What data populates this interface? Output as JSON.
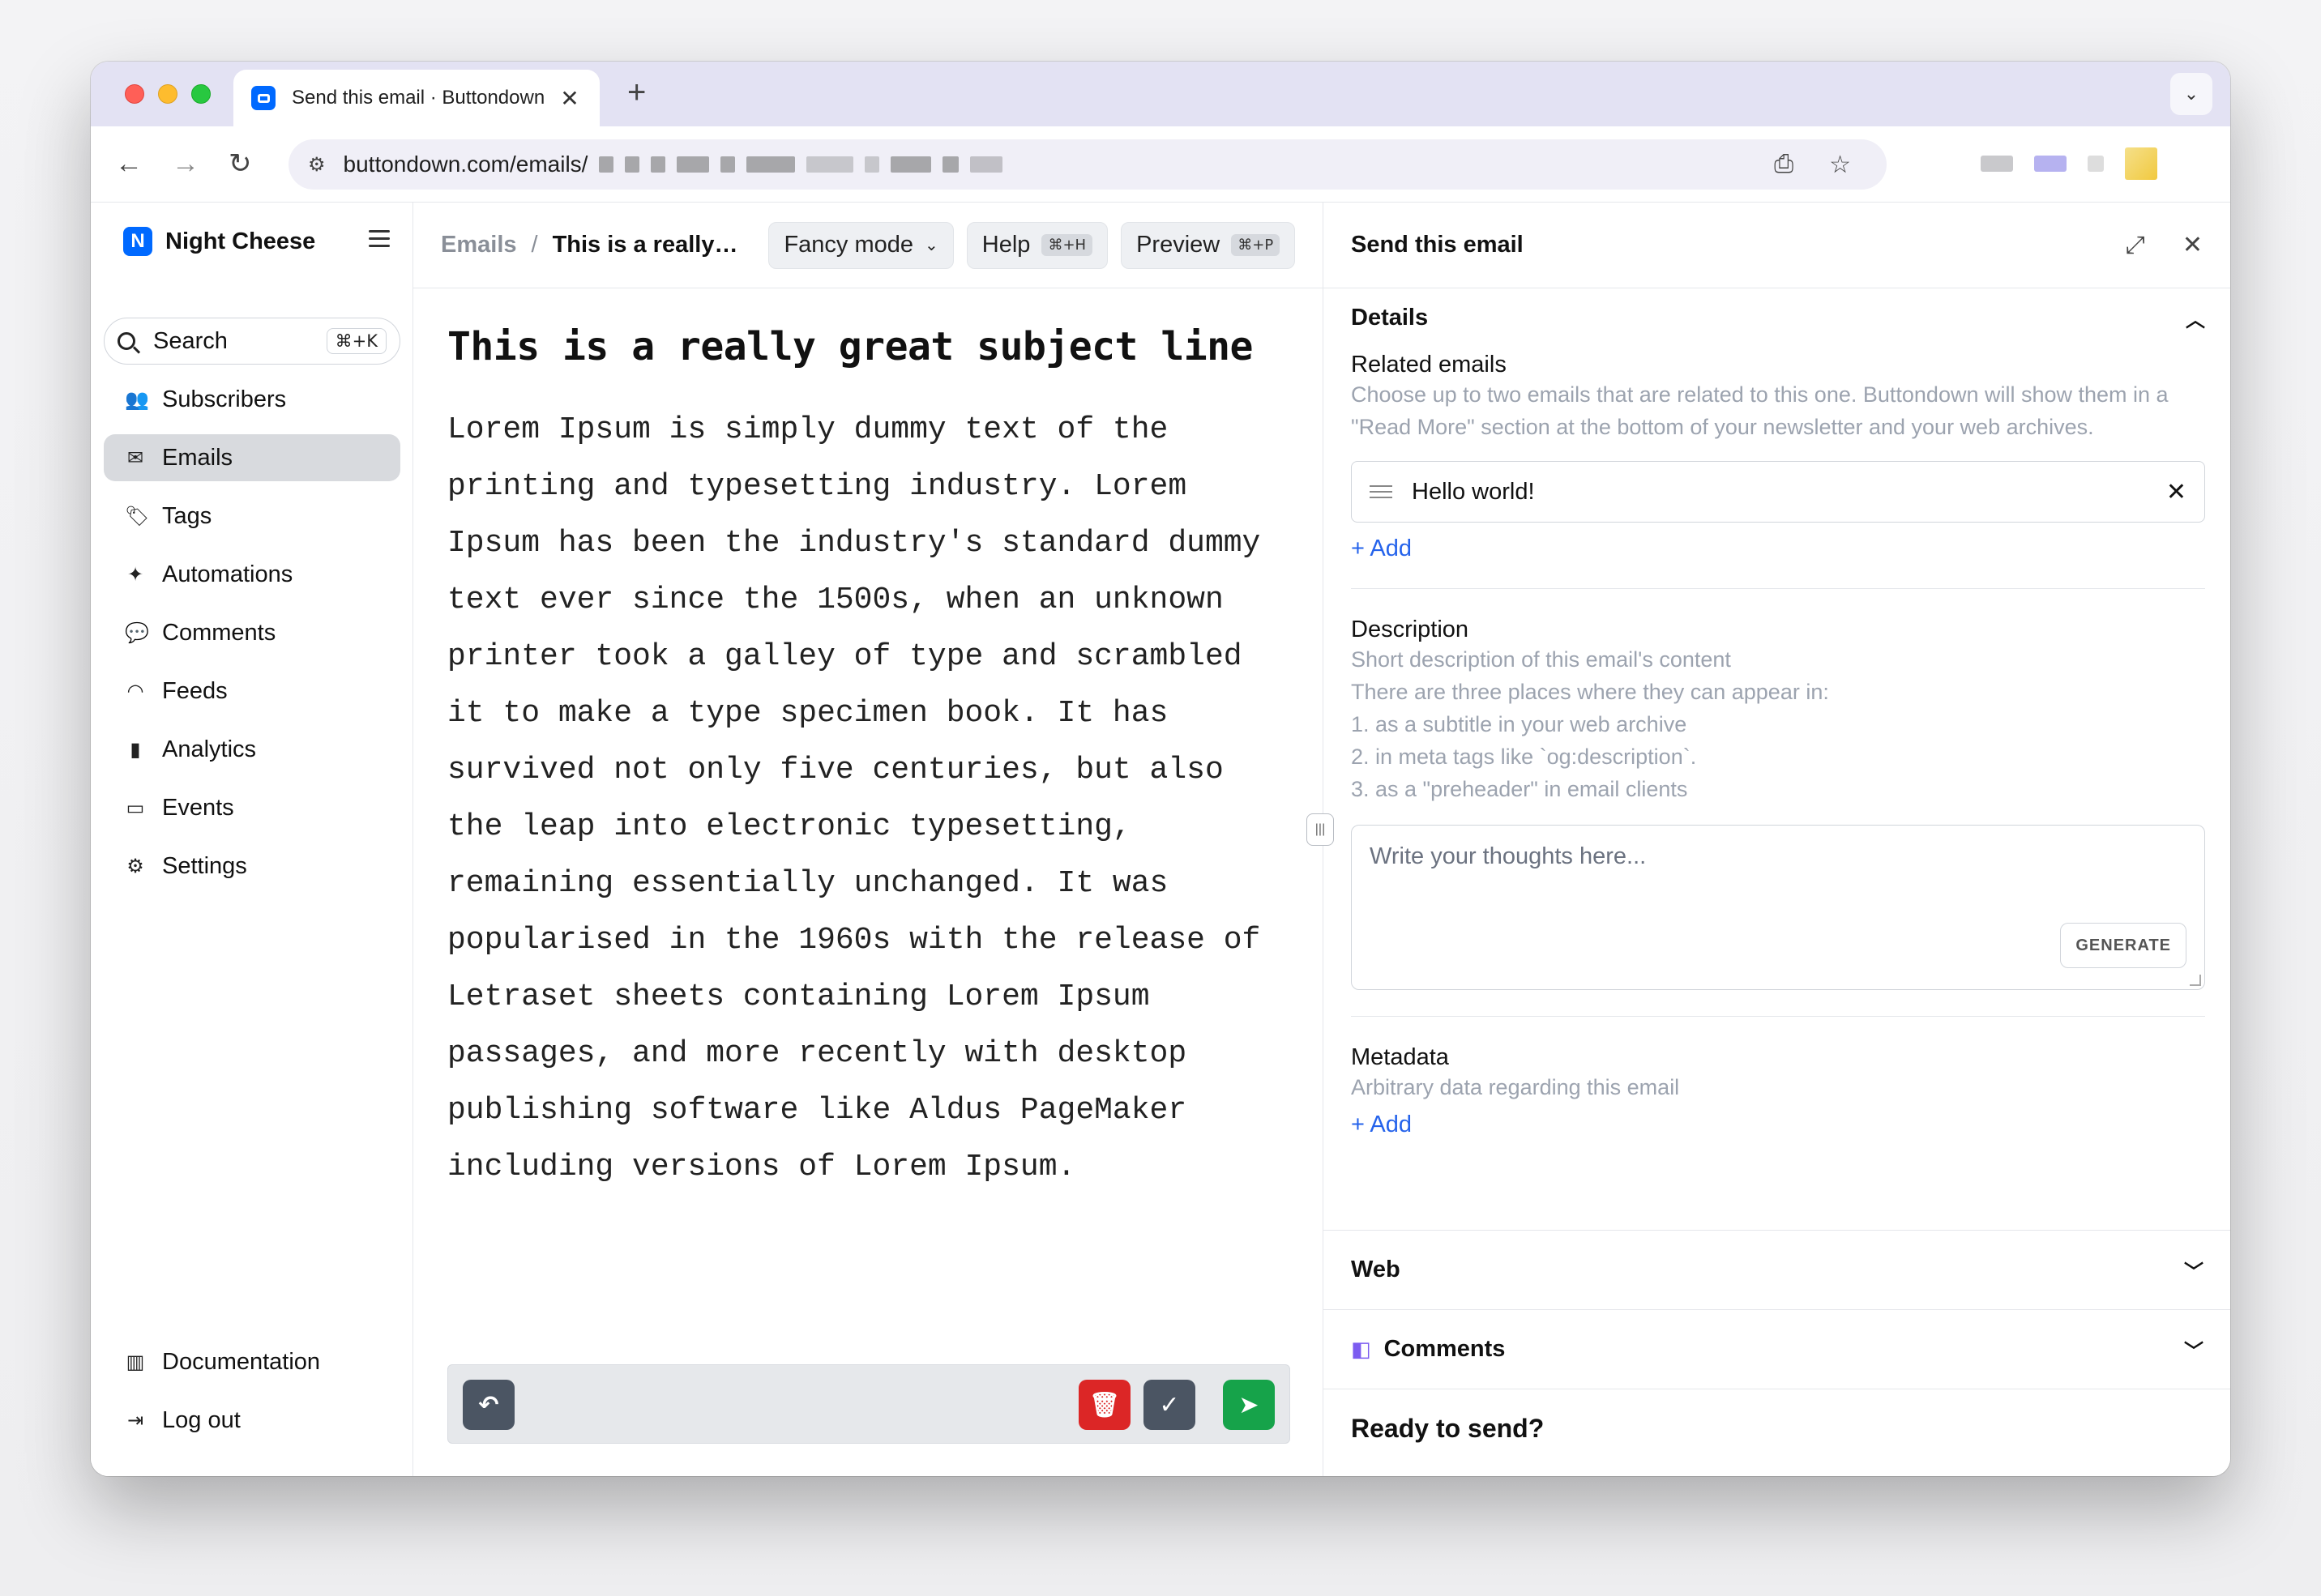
{
  "browser": {
    "tab_title": "Send this email · Buttondown",
    "url": "buttondown.com/emails/"
  },
  "sidebar": {
    "brand": "Night Cheese",
    "brand_initial": "N",
    "search_label": "Search",
    "search_shortcut": "⌘+K",
    "items": [
      {
        "label": "Subscribers",
        "icon": "users-icon"
      },
      {
        "label": "Emails",
        "icon": "envelope-icon",
        "active": true
      },
      {
        "label": "Tags",
        "icon": "tag-icon"
      },
      {
        "label": "Automations",
        "icon": "sparkles-icon"
      },
      {
        "label": "Comments",
        "icon": "comments-icon"
      },
      {
        "label": "Feeds",
        "icon": "rss-icon"
      },
      {
        "label": "Analytics",
        "icon": "bar-chart-icon"
      },
      {
        "label": "Events",
        "icon": "calendar-icon"
      },
      {
        "label": "Settings",
        "icon": "gear-icon"
      }
    ],
    "bottom_items": [
      {
        "label": "Documentation",
        "icon": "book-icon"
      },
      {
        "label": "Log out",
        "icon": "logout-icon"
      }
    ]
  },
  "editor": {
    "breadcrumb_root": "Emails",
    "breadcrumb_current": "This is a really…",
    "fancy_mode": "Fancy mode",
    "help": "Help",
    "help_shortcut": "⌘+H",
    "preview": "Preview",
    "preview_shortcut": "⌘+P",
    "subject": "This is a really great subject line",
    "body": "Lorem Ipsum is simply dummy text of the printing and typesetting industry. Lorem Ipsum has been the industry's standard dummy text ever since the 1500s, when an unknown printer took a galley of type and scrambled it to make a type specimen book. It has survived not only five centuries, but also the leap into electronic typesetting, remaining essentially unchanged. It was popularised in the 1960s with the release of Letraset sheets containing Lorem Ipsum passages, and more recently with desktop publishing software like Aldus PageMaker including versions of Lorem Ipsum."
  },
  "panel": {
    "title": "Send this email",
    "details": {
      "heading": "Details",
      "related_label": "Related emails",
      "related_help": "Choose up to two emails that are related to this one. Buttondown will show them in a \"Read More\" section at the bottom of your newsletter and your web archives.",
      "related_items": [
        "Hello world!"
      ],
      "add": "+ Add",
      "description_label": "Description",
      "description_help_1": "Short description of this email's content",
      "description_help_2": "There are three places where they can appear in:",
      "description_help_3": "1. as a subtitle in your web archive",
      "description_help_4": "2. in meta tags like `og:description`.",
      "description_help_5": "3. as a \"preheader\" in email clients",
      "description_placeholder": "Write your thoughts here...",
      "generate": "GENERATE",
      "metadata_label": "Metadata",
      "metadata_help": "Arbitrary data regarding this email",
      "metadata_add": "+ Add"
    },
    "web": "Web",
    "comments": "Comments",
    "ready": "Ready to send?"
  },
  "colors": {
    "brand": "#0069ff",
    "delete": "#dc2626",
    "send": "#15a34a",
    "check": "#4b5563",
    "link": "#2563eb"
  }
}
